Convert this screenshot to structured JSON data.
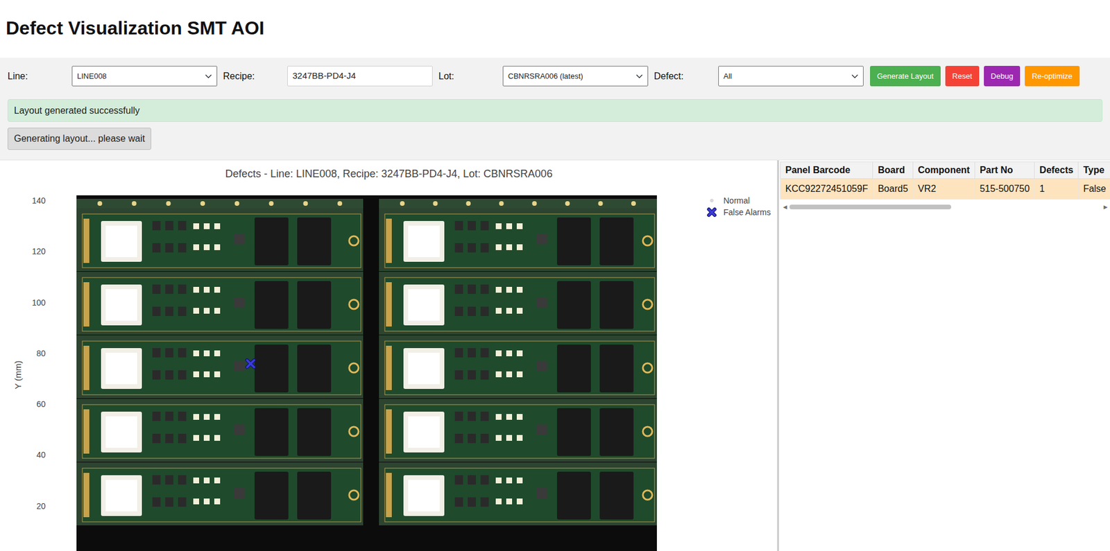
{
  "page": {
    "title": "Defect Visualization SMT AOI"
  },
  "controls": [
    {
      "label": "Line:",
      "kind": "select",
      "value": "LINE008"
    },
    {
      "label": "Recipe:",
      "kind": "input",
      "value": "3247BB-PD4-J4"
    },
    {
      "label": "Lot:",
      "kind": "select",
      "value": "CBNRSRA006 (latest)"
    },
    {
      "label": "Defect:",
      "kind": "select",
      "value": "All"
    }
  ],
  "buttons": [
    {
      "label": "Generate Layout",
      "color": "#4caf50"
    },
    {
      "label": "Reset",
      "color": "#f44336"
    },
    {
      "label": "Debug",
      "color": "#9c27b0"
    },
    {
      "label": "Re-optimize",
      "color": "#ff9800"
    }
  ],
  "messages": {
    "success": "Layout generated successfully",
    "loading": "Generating layout... please wait"
  },
  "chart": {
    "title": "Defects - Line: LINE008, Recipe: 3247BB-PD4-J4, Lot: CBNRSRA006",
    "y_axis": {
      "label": "Y (mm)",
      "ticks": [
        "140",
        "120",
        "100",
        "80",
        "60",
        "40",
        "20"
      ]
    },
    "series": [
      {
        "name": "Normal",
        "kind": "dot",
        "color": "#d9d9d9",
        "x": [],
        "y": []
      },
      {
        "name": "False Alarms",
        "kind": "cross",
        "color": "#3b3bdc",
        "x": [
          68.3
        ],
        "y": [
          75.9
        ]
      }
    ]
  },
  "table": {
    "columns": [
      "Panel Barcode",
      "Board",
      "Component",
      "Part No",
      "Defects",
      "Type"
    ],
    "rows": [
      {
        "cells": [
          "KCC92272451059F",
          "Board5",
          "VR2",
          "515-500750",
          "1",
          "False"
        ],
        "selected": true
      }
    ]
  },
  "scrollbar": {
    "left": "◀",
    "right": "▶",
    "level": 0.52
  }
}
